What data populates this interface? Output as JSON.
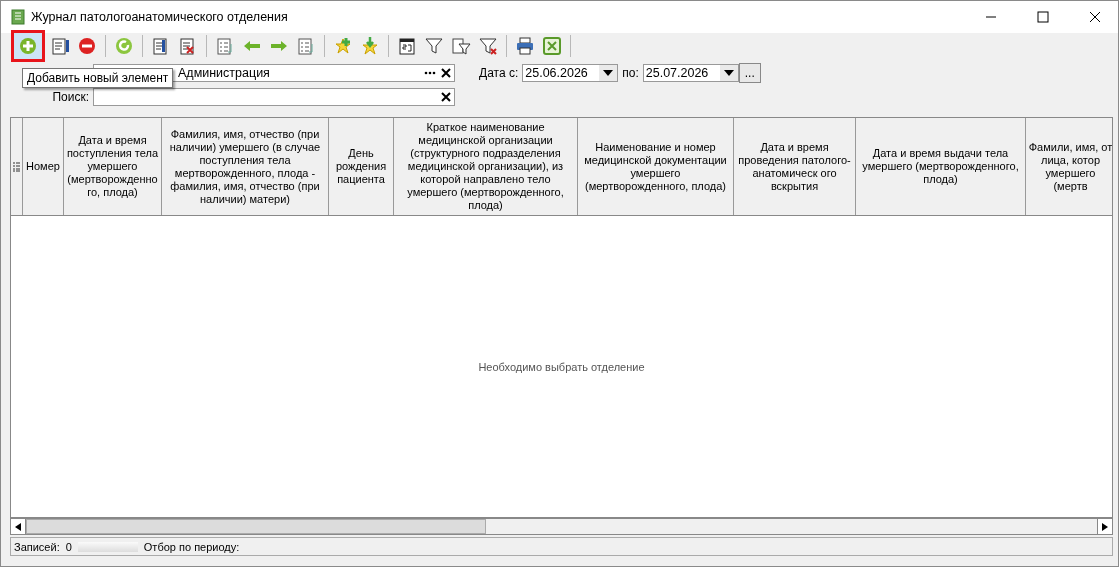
{
  "window": {
    "title": "Журнал патологоанатомического отделения"
  },
  "toolbar": [
    {
      "kind": "add",
      "selected": true
    },
    {
      "kind": "edit",
      "selected": false
    },
    {
      "kind": "delete",
      "selected": false
    },
    {
      "kind": "separator"
    },
    {
      "kind": "refresh",
      "selected": false
    },
    {
      "kind": "separator"
    },
    {
      "kind": "doc-check",
      "selected": false
    },
    {
      "kind": "doc-cross",
      "selected": false
    },
    {
      "kind": "separator"
    },
    {
      "kind": "list",
      "selected": false
    },
    {
      "kind": "arrow-left",
      "selected": false
    },
    {
      "kind": "arrow-right",
      "selected": false
    },
    {
      "kind": "list",
      "selected": false
    },
    {
      "kind": "separator"
    },
    {
      "kind": "star-plus",
      "selected": false
    },
    {
      "kind": "star-down",
      "selected": false
    },
    {
      "kind": "separator"
    },
    {
      "kind": "calendar",
      "selected": false
    },
    {
      "kind": "filter",
      "selected": false
    },
    {
      "kind": "filter-doc",
      "selected": false
    },
    {
      "kind": "filter-cross",
      "selected": false
    },
    {
      "kind": "separator"
    },
    {
      "kind": "printer",
      "selected": false
    },
    {
      "kind": "excel",
      "selected": false
    },
    {
      "kind": "separator"
    }
  ],
  "tooltip": "Добавить новый элемент",
  "filters": {
    "department_value": "Администрация",
    "search_label": "Поиск:",
    "date_from_label": "Дата с:",
    "date_from": "25.06.2026",
    "date_to_label": "по:",
    "date_to": "25.07.2026",
    "period_button": "..."
  },
  "table": {
    "columns": [
      {
        "label": "Номер"
      },
      {
        "label": "Дата и время поступления тела умершего (мертворожденно го, плода)"
      },
      {
        "label": "Фамилия, имя, отчество (при наличии) умершего (в случае поступления тела мертворожденного, плода - фамилия, имя, отчество (при наличии) матери)"
      },
      {
        "label": "День рождения пациента"
      },
      {
        "label": "Краткое наименование медицинской организации (структурного подразделения медицинской организации), из которой направлено тело умершего (мертворожденного, плода)"
      },
      {
        "label": "Наименование и номер медицинской документации умершего (мертворожденного, плода)"
      },
      {
        "label": "Дата и время проведения патолого-анатомическ ого вскрытия"
      },
      {
        "label": "Дата и время выдачи тела умершего (мертворожденного, плода)"
      },
      {
        "label": "Фамили, имя, от\nлица, котор\nумершего (мертв"
      }
    ],
    "empty_message": "Необходимо выбрать отделение"
  },
  "status_bar": {
    "records_label": "Записей:",
    "records": "0",
    "period_label": "Отбор по периоду:"
  }
}
